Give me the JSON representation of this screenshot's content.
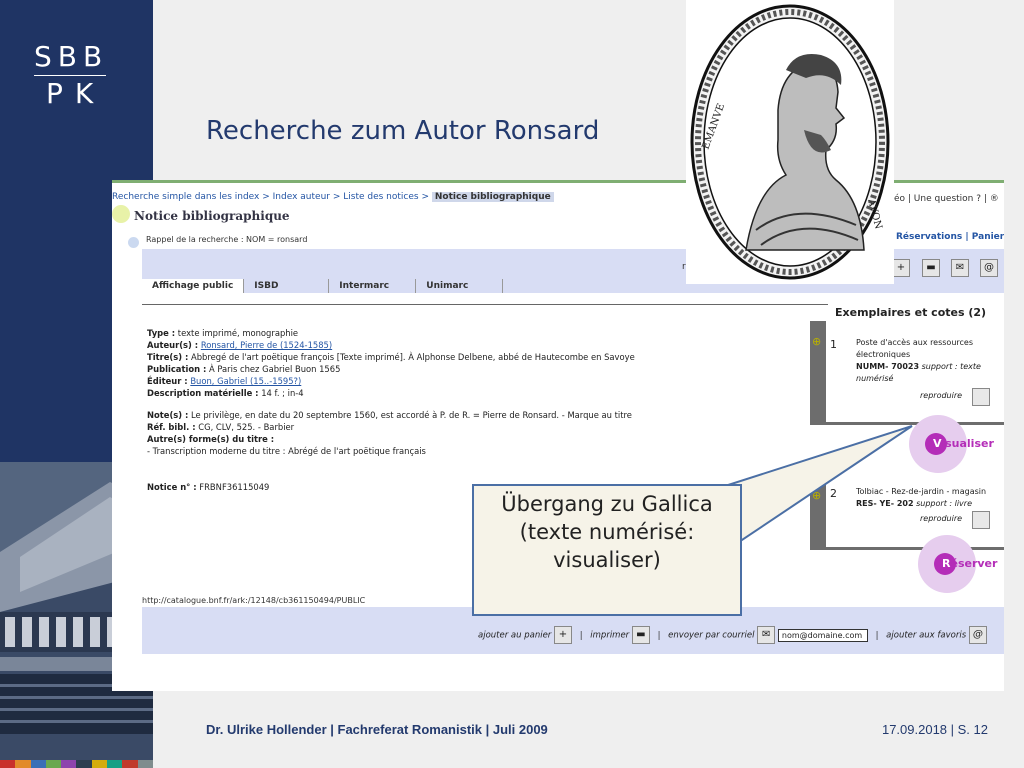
{
  "logo": {
    "line1": "SBB",
    "line2": "PK"
  },
  "slide_title": "Recherche zum Autor Ronsard",
  "catalog": {
    "breadcrumb": {
      "items": [
        "Recherche simple dans les index",
        "Index auteur",
        "Liste des notices"
      ],
      "separator": " > ",
      "current": "Notice bibliographique"
    },
    "top_links": "éo | Une question ? | ®",
    "notice_heading": "Notice bibliographique",
    "rappel": "Rappel de la recherche : NOM = ronsard",
    "reservations_link": "Réservations | Panier",
    "tabs": [
      {
        "label": "Affichage public",
        "active": true
      },
      {
        "label": "ISBD",
        "active": false
      },
      {
        "label": "Intermarc",
        "active": false
      },
      {
        "label": "Unimarc",
        "active": false
      }
    ],
    "record": {
      "type_label": "Type :",
      "type_value": "texte imprimé, monographie",
      "auteur_label": "Auteur(s) :",
      "auteur_value": "Ronsard, Pierre de (1524-1585)",
      "titre_label": "Titre(s) :",
      "titre_value": "Abbregé de l'art poëtique françois [Texte imprimé]. À Alphonse Delbene, abbé de Hautecombe en Savoye",
      "publication_label": "Publication :",
      "publication_value": "À Paris chez Gabriel Buon 1565",
      "editeur_label": "Éditeur :",
      "editeur_value": "Buon, Gabriel (15..-1595?)",
      "description_label": "Description matérielle :",
      "description_value": "14 f. ; in-4",
      "notes_label": "Note(s) :",
      "notes_value": "Le privilège, en date du 20 septembre 1560, est accordé à P. de R. = Pierre de Ronsard. - Marque au titre",
      "refbibl_label": "Réf. bibl. :",
      "refbibl_value": "CG, CLV, 525. - Barbier",
      "autres_label": "Autre(s) forme(s) du titre :",
      "autres_value": "- Transcription moderne du titre : Abrégé de l'art poëtique français",
      "noticeno_label": "Notice n° :",
      "noticeno_value": "FRBNF36115049"
    },
    "url": "http://catalogue.bnf.fr/ark:/12148/cb361150494/PUBLIC",
    "actions": {
      "panier": "ajouter au panier",
      "imprimer": "imprimer",
      "courriel": "envoyer par courriel",
      "email_value": "nom@domaine.com",
      "favoris": "ajouter aux favoris",
      "separator": "|"
    },
    "exemplaires": {
      "title": "Exemplaires et cotes (2)",
      "items": [
        {
          "num": "1",
          "line1": "Poste d'accès aux ressources",
          "line2": "électroniques",
          "cote": "NUMM- 70023",
          "support": "support : texte",
          "support2": "numérisé",
          "reproduire": "reproduire",
          "button_first": "V",
          "button_rest": "isualiser"
        },
        {
          "num": "2",
          "line1": "Tolbiac - Rez-de-jardin - magasin",
          "cote": "RES- YE- 202",
          "support": "support : livre",
          "reproduire": "reproduire",
          "button_first": "R",
          "button_rest": "éserver"
        }
      ]
    },
    "partial_text_r": "r"
  },
  "callout": {
    "line1": "Übergang zu Gallica",
    "line2": "(texte numérisé:",
    "line3": "visualiser)"
  },
  "portrait": {
    "legend_left": "EMANVE",
    "legend_right": "AVON"
  },
  "footer": {
    "left": "Dr. Ulrike Hollender | Fachreferat Romanistik | Juli 2009",
    "right": "17.09.2018 | S. 12"
  },
  "colors": {
    "navy": "#1f3464",
    "title_blue": "#233a6e",
    "link_blue": "#2455a4",
    "panel_lavender": "#d8ddf4",
    "accent_magenta": "#b42db8",
    "callout_border": "#4b6fa5"
  }
}
